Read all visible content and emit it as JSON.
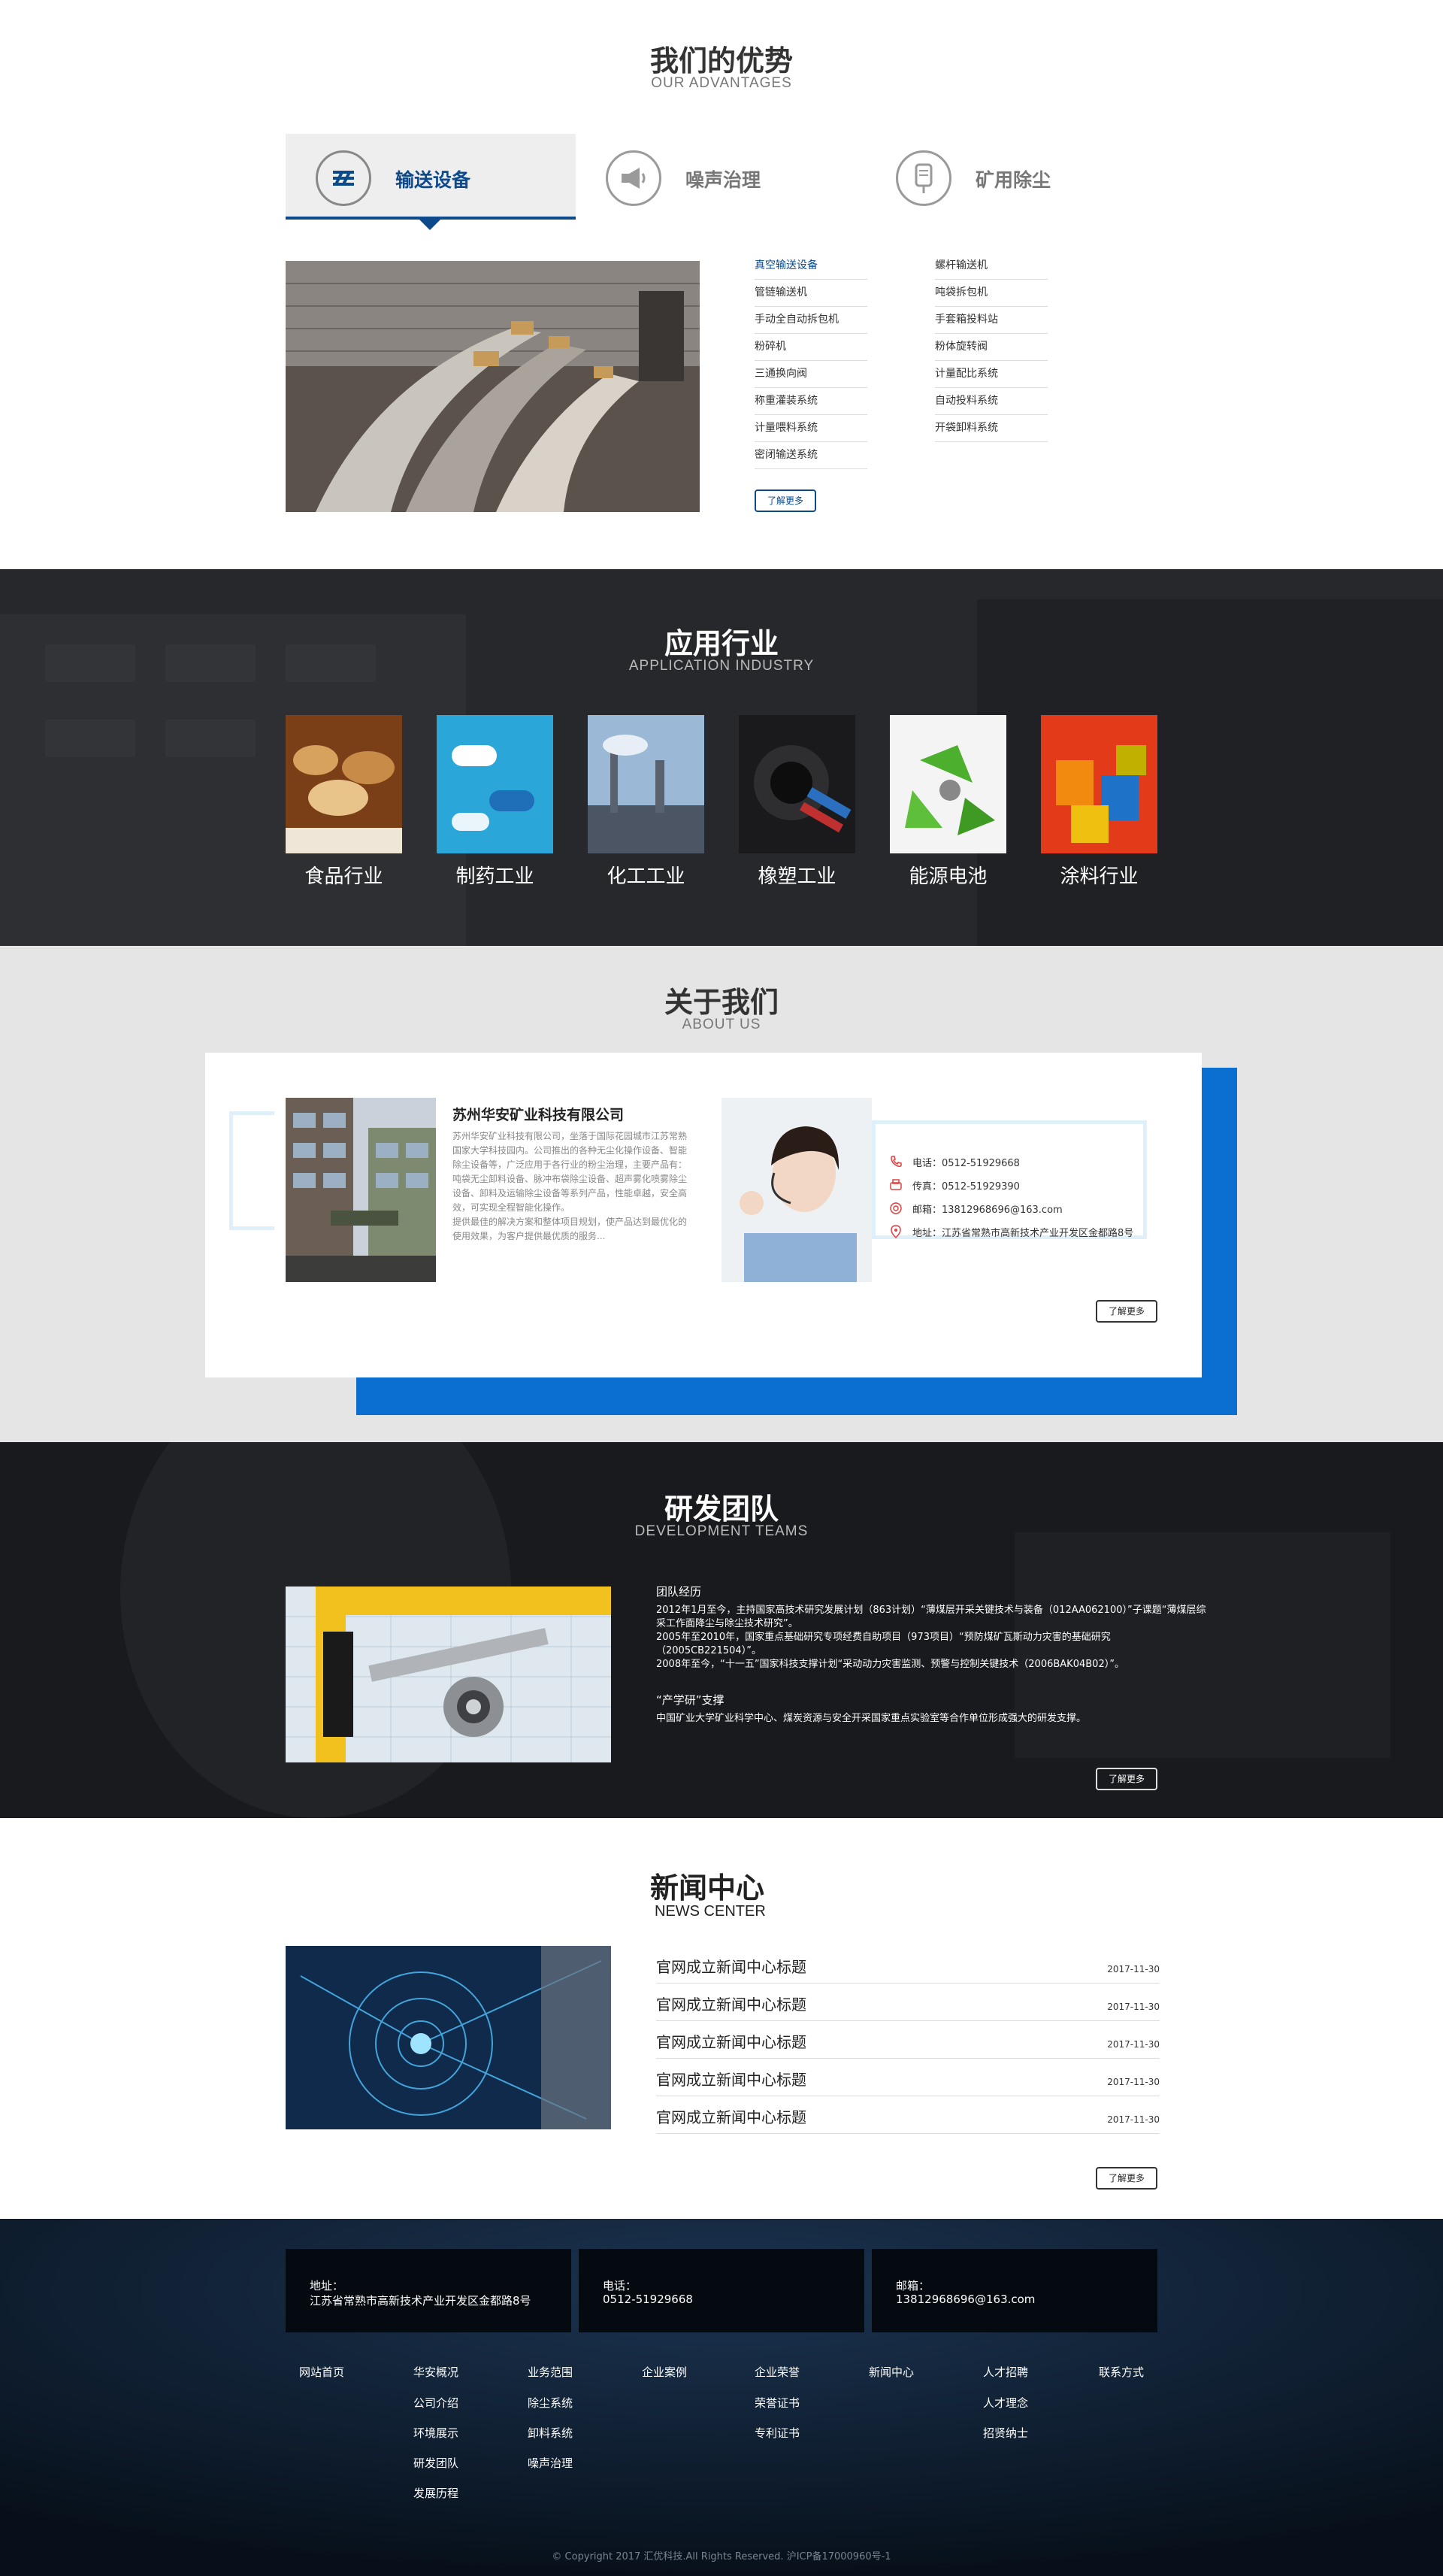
{
  "advantages": {
    "title": "我们的优势",
    "subtitle": "OUR ADVANTAGES",
    "tabs": [
      {
        "label": "输送设备",
        "icon": "conveyor-icon",
        "active": true
      },
      {
        "label": "噪声治理",
        "icon": "megaphone-icon",
        "active": false
      },
      {
        "label": "矿用除尘",
        "icon": "dust-removal-icon",
        "active": false
      }
    ],
    "products_left": [
      "真空输送设备",
      "管链输送机",
      "手动全自动拆包机",
      "粉碎机",
      "三通换向阀",
      "称重灌装系统",
      "计量喂料系统",
      "密闭输送系统"
    ],
    "products_right": [
      "螺杆输送机",
      "吨袋拆包机",
      "手套箱投料站",
      "粉体旋转阀",
      "计量配比系统",
      "自动投料系统",
      "开袋卸料系统"
    ],
    "more": "了解更多"
  },
  "industry": {
    "title": "应用行业",
    "subtitle": "APPLICATION INDUSTRY",
    "items": [
      "食品行业",
      "制药工业",
      "化工工业",
      "橡塑工业",
      "能源电池",
      "涂料行业"
    ]
  },
  "about": {
    "title": "关于我们",
    "subtitle": "ABOUT US",
    "company": "苏州华安矿业科技有限公司",
    "desc": [
      "苏州华安矿业科技有限公司，坐落于国际花园城市江苏常熟",
      "国家大学科技园内。公司推出的各种无尘化操作设备、智能",
      "除尘设备等，广泛应用于各行业的粉尘治理，主要产品有：",
      "吨袋无尘卸料设备、脉冲布袋除尘设备、超声雾化喷雾除尘",
      "设备、卸料及运输除尘设备等系列产品，性能卓越，安全高",
      "效，可实现全程智能化操作。",
      "提供最佳的解决方案和整体项目规划，使产品达到最优化的",
      "使用效果，为客户提供最优质的服务..."
    ],
    "contacts": [
      {
        "icon": "phone-icon",
        "text": "电话：0512-51929668"
      },
      {
        "icon": "fax-icon",
        "text": "传真：0512-51929390"
      },
      {
        "icon": "email-icon",
        "text": "邮箱：13812968696@163.com"
      },
      {
        "icon": "location-icon",
        "text": "地址：江苏省常熟市高新技术产业开发区金都路8号"
      }
    ],
    "more": "了解更多",
    "colors": {
      "accent": "#0a6fd0"
    }
  },
  "dev": {
    "title": "研发团队",
    "subtitle": "DEVELOPMENT TEAMS",
    "heading1": "团队经历",
    "lines": [
      "2012年1月至今，主持国家高技术研究发展计划（863计划）“薄煤层开采关键技术与装备（012AA062100）”子课题“薄煤层综",
      "采工作面降尘与除尘技术研究”。",
      "2005年至2010年，国家重点基础研究专项经费自助项目（973项目）“预防煤矿瓦斯动力灾害的基础研究",
      "（2005CB221504）”。",
      "2008年至今，“十一五”国家科技支撑计划“采动动力灾害监测、预警与控制关键技术（2006BAK04B02）”。"
    ],
    "heading2": "“产学研”支撑",
    "line2": "中国矿业大学矿业科学中心、煤炭资源与安全开采国家重点实验室等合作单位形成强大的研发支撑。",
    "more": "了解更多"
  },
  "news": {
    "title": "新闻中心",
    "subtitle": "NEWS CENTER",
    "items": [
      {
        "title": "官网成立新闻中心标题",
        "date": "2017-11-30"
      },
      {
        "title": "官网成立新闻中心标题",
        "date": "2017-11-30"
      },
      {
        "title": "官网成立新闻中心标题",
        "date": "2017-11-30"
      },
      {
        "title": "官网成立新闻中心标题",
        "date": "2017-11-30"
      },
      {
        "title": "官网成立新闻中心标题",
        "date": "2017-11-30"
      }
    ],
    "more": "了解更多"
  },
  "footer": {
    "boxes": [
      {
        "label": "地址：",
        "value": "江苏省常熟市高新技术产业开发区金都路8号"
      },
      {
        "label": "电话：",
        "value": "0512-51929668"
      },
      {
        "label": "邮箱：",
        "value": "13812968696@163.com"
      }
    ],
    "nav": [
      {
        "head": "网站首页",
        "subs": []
      },
      {
        "head": "华安概况",
        "subs": [
          "公司介绍",
          "环境展示",
          "研发团队",
          "发展历程"
        ]
      },
      {
        "head": "业务范围",
        "subs": [
          "除尘系统",
          "卸料系统",
          "噪声治理"
        ]
      },
      {
        "head": "企业案例",
        "subs": []
      },
      {
        "head": "企业荣誉",
        "subs": [
          "荣誉证书",
          "专利证书"
        ]
      },
      {
        "head": "新闻中心",
        "subs": []
      },
      {
        "head": "人才招聘",
        "subs": [
          "人才理念",
          "招贤纳士"
        ]
      },
      {
        "head": "联系方式",
        "subs": []
      }
    ],
    "copyright": "© Copyright 2017 汇优科技.All Rights Reserved. 沪ICP备17000960号-1"
  }
}
